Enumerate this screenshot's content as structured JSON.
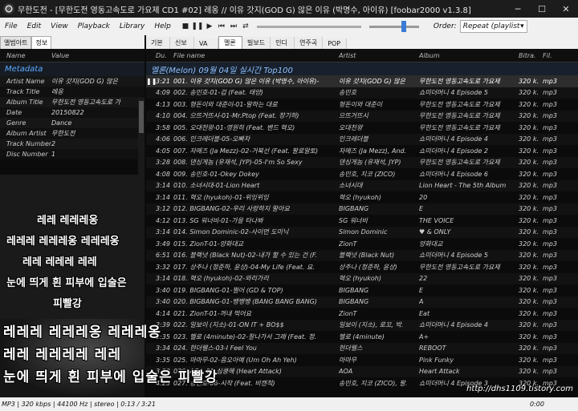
{
  "window": {
    "title": "무한도전 - [무한도전 영동고속도로 가요제 CD1 #02] 레옹 // 이유 갓지(GOD G) 않은 이유 (박명수, 아이유)    [foobar2000 v1.3.8]"
  },
  "menu": {
    "items": [
      "File",
      "Edit",
      "View",
      "Playback",
      "Library",
      "Help"
    ],
    "order_label": "Order:",
    "order_value": "Repeat (playlist"
  },
  "left_tabs": [
    "앨범아트",
    "정보"
  ],
  "properties": {
    "headers": {
      "name": "Name",
      "value": "Value"
    },
    "group": "Metadata",
    "rows": [
      {
        "k": "Artist Name",
        "v": "이유 갓지(GOD G) 않은"
      },
      {
        "k": "Track Title",
        "v": "레옹"
      },
      {
        "k": "Album Title",
        "v": "무한도전 영동고속도로 가"
      },
      {
        "k": "Date",
        "v": "20150822"
      },
      {
        "k": "Genre",
        "v": "Dance"
      },
      {
        "k": "Album Artist",
        "v": "무한도전"
      },
      {
        "k": "Track Number",
        "v": "2"
      },
      {
        "k": "Disc Number",
        "v": "1"
      }
    ]
  },
  "lyrics": {
    "lines": [
      "레레 레레레옹",
      "레레레 레레레옹 레레레옹",
      "레레 레레레 레레",
      "눈에 띄게 흰 피부에 입술은",
      "피빨강",
      "레레레 레레레옹 레레레옹",
      "레레 레레레레 레레",
      "눈에 띄게 흰 피부에 입술은 피빨강"
    ]
  },
  "right_tabs": [
    "기본",
    "신보",
    "VA",
    "멜론",
    "빌보드",
    "인디",
    "연주곡",
    "POP"
  ],
  "columns": {
    "dur": "Du.",
    "file": "File name",
    "artist": "Artist",
    "album": "Album",
    "bitrate": "Bitra.",
    "filetype": "Fil."
  },
  "group_header": "멜론(Melon) 09월 04일 실시간 Top100",
  "playlist": [
    {
      "dur": "3:21",
      "file": "001. 이유 갓지(GOD G) 않은 이유 (박명수, 아이유)-",
      "artist": "이유 갓지(GOD G) 않은",
      "album": "무한도전 영동고속도로 가요제",
      "br": "320 k.",
      "ft": "mp3",
      "playing": true
    },
    {
      "dur": "4:09",
      "file": "002. 송민호-01-겁 (Feat. 태양)",
      "artist": "송민호",
      "album": "쇼미더머니 4 Episode 5",
      "br": "320 k.",
      "ft": "mp3"
    },
    {
      "dur": "4:13",
      "file": "003. 형돈이와 대준이-01-말하는 대로",
      "artist": "형돈이와 대준이",
      "album": "무한도전 영동고속도로 가요제",
      "br": "320 k.",
      "ft": "mp3"
    },
    {
      "dur": "4:10",
      "file": "004. 으뜨거뜨시-01-Mr.Ptop (Feat. 장기하)",
      "artist": "으뜨거뜨시",
      "album": "무한도전 영동고속도로 가요제",
      "br": "320 k.",
      "ft": "mp3"
    },
    {
      "dur": "3:58",
      "file": "005. 오대천왕-01-영원히 (Feat. 밴드 혁오)",
      "artist": "오대천왕",
      "album": "무한도전 영동고속도로 가요제",
      "br": "320 k.",
      "ft": "mp3"
    },
    {
      "dur": "4:06",
      "file": "006. 인크레더블-05-오빠차",
      "artist": "인크레더블",
      "album": "쇼미더머니 4 Episode 4",
      "br": "320 k.",
      "ft": "mp3"
    },
    {
      "dur": "4:05",
      "file": "007. 자메즈 (Ja Mezz)-02-거북선 (Feat. 팔로알토)",
      "artist": "자메즈 (Ja Mezz), And.",
      "album": "쇼미더머니 4 Episode 2",
      "br": "320 k.",
      "ft": "mp3"
    },
    {
      "dur": "3:28",
      "file": "008. 댄싱게놈 (유재석, JYP)-05-I'm So Sexy",
      "artist": "댄싱게놈 (유재석, JYP)",
      "album": "무한도전 영동고속도로 가요제",
      "br": "320 k.",
      "ft": "mp3"
    },
    {
      "dur": "4:08",
      "file": "009. 송민호-01-Okey Dokey",
      "artist": "송민호, 지코 (ZICO)",
      "album": "쇼미더머니 4 Episode 6",
      "br": "320 k.",
      "ft": "mp3"
    },
    {
      "dur": "3:14",
      "file": "010. 소녀시대-01-Lion Heart",
      "artist": "소녀시대",
      "album": "Lion Heart - The 5th Album",
      "br": "320 k.",
      "ft": "mp3"
    },
    {
      "dur": "3:14",
      "file": "011. 혁오 (hyukoh)-01-위잉위잉",
      "artist": "혁오 (hyukoh)",
      "album": "20",
      "br": "320 k.",
      "ft": "mp3"
    },
    {
      "dur": "3:12",
      "file": "012. BIGBANG-02-우리 사랑하지 말아요",
      "artist": "BIGBANG",
      "album": "E",
      "br": "320 k.",
      "ft": "mp3"
    },
    {
      "dur": "4:12",
      "file": "013. SG 워너비-01-가을 타나봐",
      "artist": "SG 워너비",
      "album": "THE VOICE",
      "br": "320 k.",
      "ft": "mp3"
    },
    {
      "dur": "3:14",
      "file": "014. Simon Dominic-02-사이먼 도미닉",
      "artist": "Simon Dominic",
      "album": "♥ & ONLY",
      "br": "320 k.",
      "ft": "mp3"
    },
    {
      "dur": "3:49",
      "file": "015. ZionT-01-양화대교",
      "artist": "ZionT",
      "album": "양화대교",
      "br": "320 k.",
      "ft": "mp3"
    },
    {
      "dur": "6:51",
      "file": "016. 블랙넛 (Black Nut)-02-내가 할 수 있는 건 (F.",
      "artist": "블랙넛 (Black Nut)",
      "album": "쇼미더머니 4 Episode 5",
      "br": "320 k.",
      "ft": "mp3"
    },
    {
      "dur": "3:32",
      "file": "017. 상주나 (정준하, 윤상)-04-My Life (Feat. 요.",
      "artist": "상주나 (정준하, 윤상)",
      "album": "무한도전 영동고속도로 가요제",
      "br": "320 k.",
      "ft": "mp3"
    },
    {
      "dur": "3:14",
      "file": "018. 혁오 (hyukoh)-02-와리가리",
      "artist": "혁오 (hyukoh)",
      "album": "22",
      "br": "320 k.",
      "ft": "mp3"
    },
    {
      "dur": "3:40",
      "file": "019. BIGBANG-01-쩔어 (GD & TOP)",
      "artist": "BIGBANG",
      "album": "E",
      "br": "320 k.",
      "ft": "mp3"
    },
    {
      "dur": "3:40",
      "file": "020. BIGBANG-01-뱅뱅뱅 (BANG BANG BANG)",
      "artist": "BIGBANG",
      "album": "A",
      "br": "320 k.",
      "ft": "mp3"
    },
    {
      "dur": "4:14",
      "file": "021. ZionT-01-꺼내 먹어요",
      "artist": "ZionT",
      "album": "Eat",
      "br": "320 k.",
      "ft": "mp3"
    },
    {
      "dur": "3:39",
      "file": "022. 일보이 (지소)-01-ON IT + BO$$",
      "artist": "일보이 (지소), 로꼬, 박.",
      "album": "쇼미더머니 4 Episode 4",
      "br": "320 k.",
      "ft": "mp3"
    },
    {
      "dur": "3:35",
      "file": "023. 헬로 (4minute)-02-잘나가서 그래 (Feat. 정.",
      "artist": "헬로 (4minute)",
      "album": "A+",
      "br": "320 k.",
      "ft": "mp3"
    },
    {
      "dur": "3:34",
      "file": "024. 현더렐스-03-I Feel You",
      "artist": "현더렐스",
      "album": "REBOOT",
      "br": "320 k.",
      "ft": "mp3"
    },
    {
      "dur": "3:35",
      "file": "025. 마마무-02-음오아예 (Um Oh Ah Yeh)",
      "artist": "마마무",
      "album": "Pink Funky",
      "br": "320 k.",
      "ft": "mp3"
    },
    {
      "dur": "3:30",
      "file": "026. AOA-01-심쿵해 (Heart Attack)",
      "artist": "AOA",
      "album": "Heart Attack",
      "br": "320 k.",
      "ft": "mp3"
    },
    {
      "dur": "4:23",
      "file": "027. 송민호-06-시작 (Feat. 비캔척)",
      "artist": "송민호, 지코 (ZICO), 팔.",
      "album": "쇼미더머니 4 Episode 3",
      "br": "320 k.",
      "ft": "mp3"
    }
  ],
  "status": {
    "text": "MP3 | 320 kbps | 44100 Hz | stereo | 0:13 / 3:21",
    "time": "0:00"
  },
  "watermark": "http://dhs1109.tistory.com"
}
